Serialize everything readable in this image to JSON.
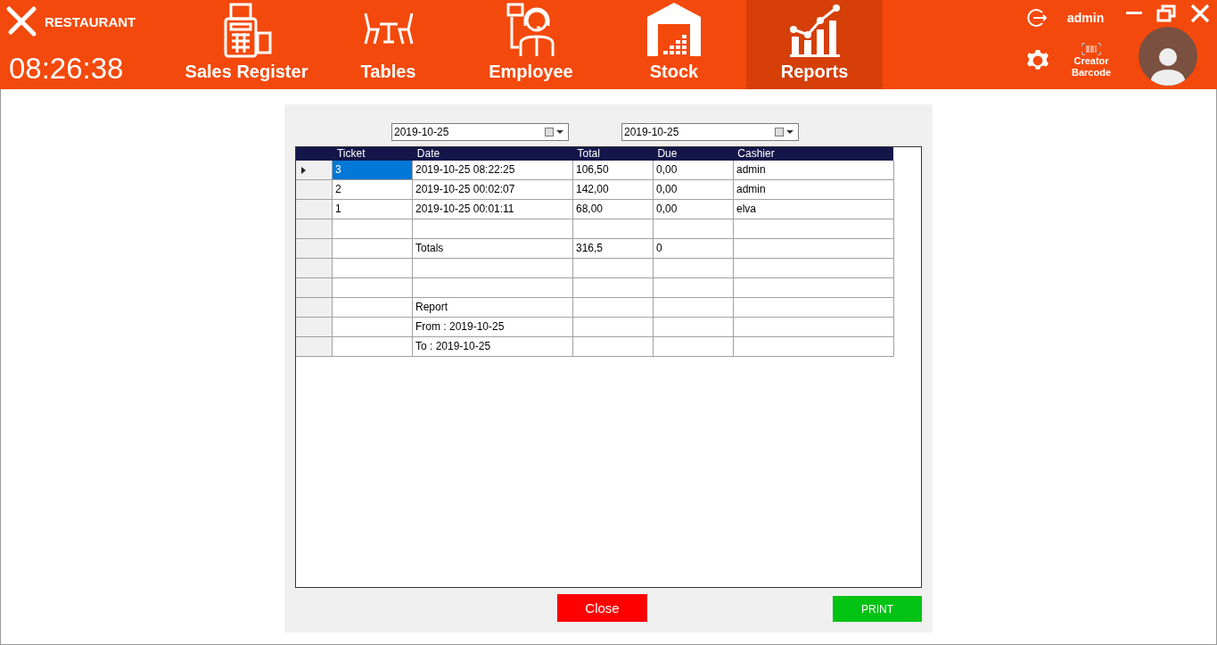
{
  "app": {
    "name": "RESTAURANT",
    "clock": "08:26:38"
  },
  "nav": [
    {
      "label": "Sales Register",
      "selected": false
    },
    {
      "label": "Tables",
      "selected": false
    },
    {
      "label": "Employee",
      "selected": false
    },
    {
      "label": "Stock",
      "selected": false
    },
    {
      "label": "Reports",
      "selected": true
    }
  ],
  "user": {
    "name": "admin",
    "barcode_label": "Creator Barcode"
  },
  "filters": {
    "from": "2019-10-25",
    "to": "2019-10-25"
  },
  "table": {
    "columns": [
      "Ticket",
      "Date",
      "Total",
      "Due",
      "Cashier"
    ],
    "rows": [
      {
        "selected": true,
        "cells": [
          "3",
          "2019-10-25 08:22:25",
          "106,50",
          "0,00",
          "admin"
        ]
      },
      {
        "selected": false,
        "cells": [
          "2",
          "2019-10-25 00:02:07",
          "142,00",
          "0,00",
          "admin"
        ]
      },
      {
        "selected": false,
        "cells": [
          "1",
          "2019-10-25 00:01:11",
          "68,00",
          "0,00",
          "elva"
        ]
      },
      {
        "selected": false,
        "cells": [
          "",
          "",
          "",
          "",
          ""
        ]
      },
      {
        "selected": false,
        "cells": [
          "",
          "Totals",
          "316,5",
          "0",
          ""
        ]
      },
      {
        "selected": false,
        "cells": [
          "",
          "",
          "",
          "",
          ""
        ]
      },
      {
        "selected": false,
        "cells": [
          "",
          "",
          "",
          "",
          ""
        ]
      },
      {
        "selected": false,
        "cells": [
          "",
          "Report",
          "",
          "",
          ""
        ]
      },
      {
        "selected": false,
        "cells": [
          "",
          "From : 2019-10-25",
          "",
          "",
          ""
        ]
      },
      {
        "selected": false,
        "cells": [
          "",
          "To : 2019-10-25",
          "",
          "",
          ""
        ]
      }
    ]
  },
  "buttons": {
    "close": "Close",
    "print": "PRINT"
  }
}
